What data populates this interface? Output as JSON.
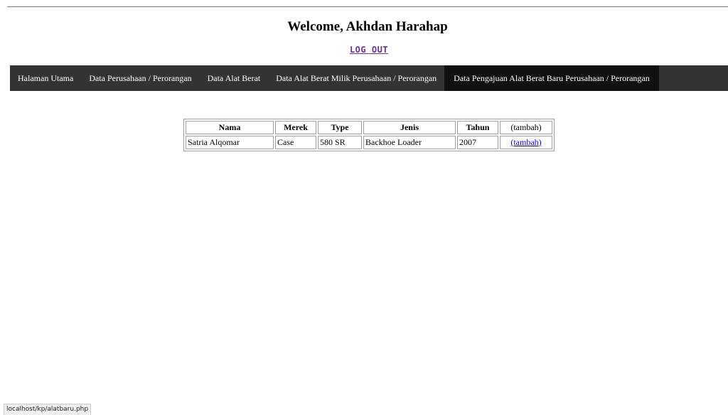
{
  "header": {
    "welcome_text": "Welcome, Akhdan Harahap",
    "logout_label": "LOG OUT"
  },
  "nav": {
    "items": [
      {
        "label": "Halaman Utama",
        "active": false
      },
      {
        "label": "Data Perusahaan / Perorangan",
        "active": false
      },
      {
        "label": "Data Alat Berat",
        "active": false
      },
      {
        "label": "Data Alat Berat Milik Perusahaan / Perorangan",
        "active": false
      },
      {
        "label": "Data Pengajuan Alat Berat Baru Perusahaan / Perorangan",
        "active": true
      }
    ]
  },
  "table": {
    "headers": [
      "Nama",
      "Merek",
      "Type",
      "Jenis",
      "Tahun",
      "(tambah)"
    ],
    "rows": [
      {
        "nama": "Satria Alqomar",
        "merek": "Case",
        "type": "580 SR",
        "jenis": "Backhoe Loader",
        "tahun": "2007",
        "action": "(tambah)"
      }
    ]
  },
  "status_bar": {
    "url": "localhost/kp/alatbaru.php"
  },
  "colors": {
    "nav_bg": "#333333",
    "nav_active_bg": "#111111",
    "logout_link": "#6b2fa0",
    "table_link": "#0000ee"
  }
}
